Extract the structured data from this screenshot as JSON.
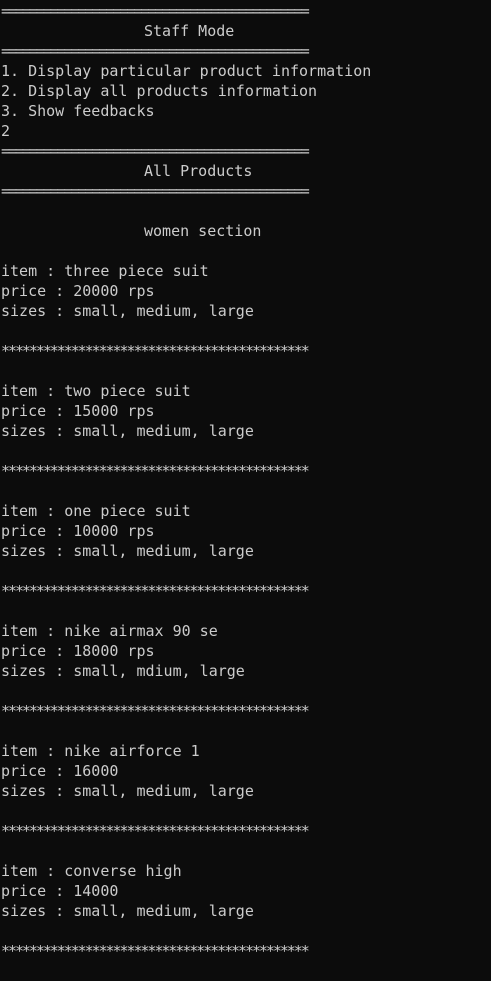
{
  "terminal": {
    "separator": "============================================",
    "title": "Staff Mode",
    "menu": [
      "1. Display particular product information",
      "2. Display all products information",
      "3. Show feedbacks"
    ],
    "input": "2",
    "heading": "All Products",
    "section": "women section",
    "products": [
      {
        "item": "item : three piece suit",
        "price": "price : 20000 rps",
        "sizes": "sizes : small, medium, large"
      },
      {
        "item": "item : two piece suit",
        "price": "price : 15000 rps",
        "sizes": "sizes : small, medium, large"
      },
      {
        "item": "item : one piece suit",
        "price": "price : 10000 rps",
        "sizes": "sizes : small, medium, large"
      },
      {
        "item": "item : nike airmax 90 se",
        "price": "price : 18000 rps",
        "sizes": "sizes : small, mdium, large"
      },
      {
        "item": "item : nike airforce 1",
        "price": "price : 16000",
        "sizes": "sizes : small, medium, large"
      },
      {
        "item": "item : converse high",
        "price": "price : 14000",
        "sizes": "sizes : small, medium, large"
      }
    ],
    "stars": "********************************************"
  },
  "colors": {
    "background": "#0c0c0c",
    "text": "#cccccc"
  }
}
